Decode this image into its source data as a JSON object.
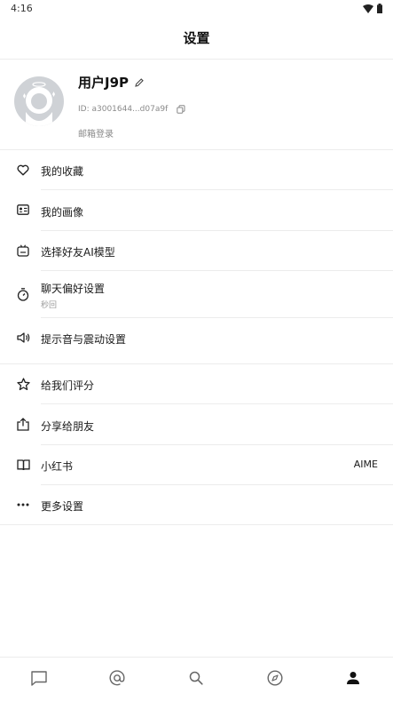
{
  "status_bar": {
    "time": "4:16"
  },
  "header": {
    "title": "设置"
  },
  "profile": {
    "username": "用户J9P",
    "user_id": "ID: a3001644...d07a9f",
    "login_type": "邮箱登录"
  },
  "menu": {
    "favorites": "我的收藏",
    "portrait": "我的画像",
    "ai_model": "选择好友AI模型",
    "chat_pref": "聊天偏好设置",
    "chat_pref_sub": "秒回",
    "sound": "提示音与震动设置",
    "rate": "给我们评分",
    "share": "分享给朋友",
    "xiaohongshu": "小红书",
    "xiaohongshu_value": "AIME",
    "more": "更多设置"
  },
  "bottom_nav": [
    "chat-icon",
    "at-icon",
    "search-icon",
    "compass-icon",
    "person-icon"
  ],
  "colors": {
    "text": "#1a1a1a",
    "muted": "#8a8a8a",
    "divider": "#ececec",
    "avatar_bg": "#cfd2d6"
  }
}
